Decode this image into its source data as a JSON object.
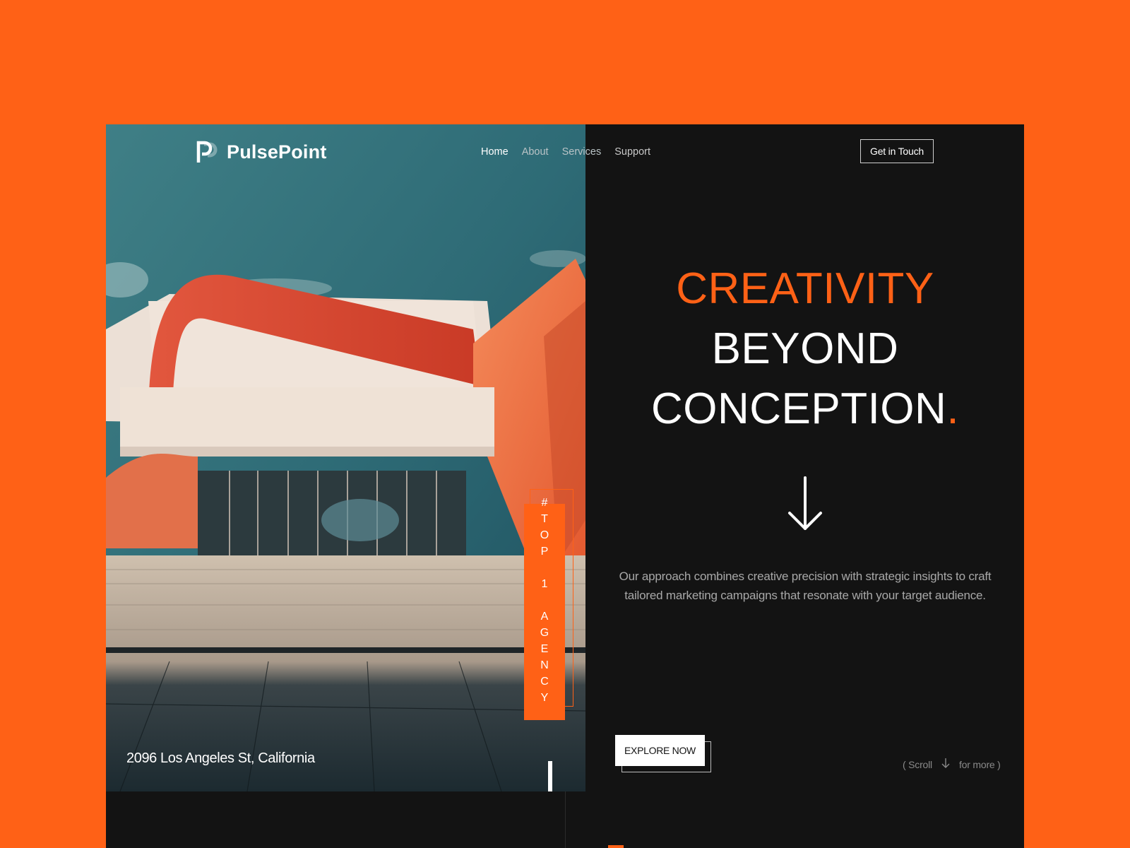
{
  "brand": {
    "name": "PulsePoint",
    "logo_icon": "p-logo-icon",
    "accent_color": "#ff6116",
    "background_color": "#131313"
  },
  "nav": {
    "items": [
      {
        "label": "Home",
        "active": true
      },
      {
        "label": "About",
        "active": false
      },
      {
        "label": "Services",
        "active": false
      },
      {
        "label": "Support",
        "active": false
      }
    ],
    "cta_label": "Get in Touch"
  },
  "hero": {
    "headline_line1": "CREATIVITY",
    "headline_line2": "BEYOND",
    "headline_line3": "CONCEPTION",
    "headline_dot": ".",
    "arrow_icon": "arrow-down-icon",
    "description": "Our approach combines creative precision with strategic insights to craft tailored marketing campaigns that resonate with your target audience.",
    "explore_label": "EXPLORE NOW",
    "scroll_hint": {
      "prefix": "( Scroll",
      "icon": "arrow-down-icon",
      "suffix": "for more )"
    }
  },
  "photo": {
    "badge_chars": [
      "#",
      "T",
      "O",
      "P",
      "",
      "1",
      "",
      "A",
      "G",
      "E",
      "N",
      "C",
      "Y"
    ],
    "address": "2096 Los Angeles St, California"
  }
}
